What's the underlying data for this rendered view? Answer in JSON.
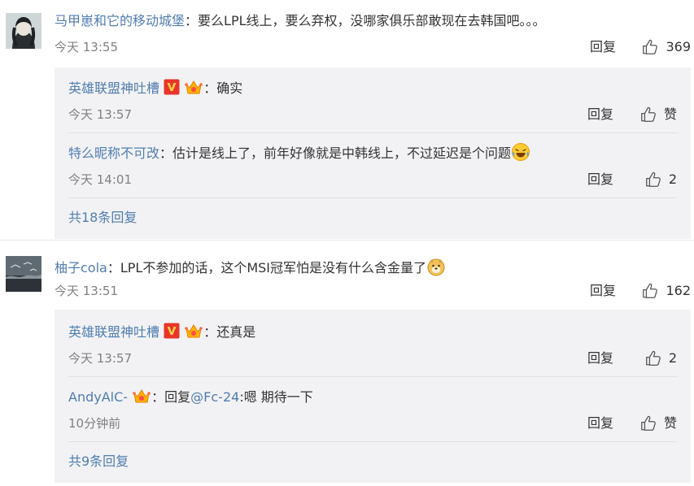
{
  "threads": [
    {
      "user": "马甲崽和它的移动城堡",
      "colon": "：",
      "text": "要么LPL线上，要么弃权，没哪家俱乐部敢现在去韩国吧。。。",
      "time": "今天 13:55",
      "reply": "回复",
      "likes": "369",
      "replies": [
        {
          "user": "英雄联盟神吐槽",
          "colon": "：",
          "text": "确实",
          "time": "今天 13:57",
          "reply": "回复",
          "likes": "赞"
        },
        {
          "user": "特么昵称不可改",
          "colon": "：",
          "text": "估计是线上了，前年好像就是中韩线上，不过延迟是个问题",
          "time": "今天 14:01",
          "reply": "回复",
          "likes": "2"
        }
      ],
      "more": "共18条回复"
    },
    {
      "user": "柚子cola",
      "colon": "：",
      "text": "LPL不参加的话，这个MSI冠军怕是没有什么含金量了",
      "time": "今天 13:51",
      "reply": "回复",
      "likes": "162",
      "replies": [
        {
          "user": "英雄联盟神吐槽",
          "colon": "：",
          "text": "还真是",
          "time": "今天 13:57",
          "reply": "回复",
          "likes": "2"
        },
        {
          "user": "AndyAlC-",
          "colon": "：",
          "pre": "回复",
          "mention": "@Fc-24",
          "text": ":嗯 期待一下",
          "time": "10分钟前",
          "reply": "回复",
          "likes": "赞"
        }
      ],
      "more": "共9条回复"
    }
  ],
  "colors": {
    "link": "#507daf",
    "text": "#333333",
    "time": "#808080",
    "subbg": "#f2f2f5"
  },
  "icons": [
    "thumbs-up-icon",
    "verified-v-icon",
    "member-crown-icon",
    "laugh-cry-emoji",
    "doge-emoji"
  ]
}
